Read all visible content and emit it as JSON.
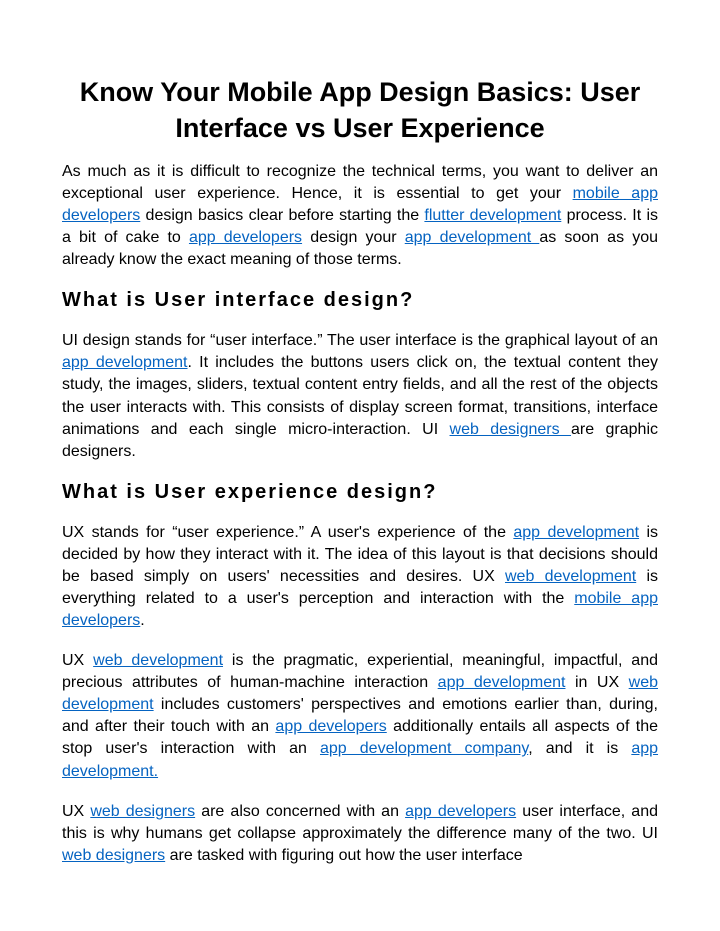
{
  "title": "Know Your Mobile App Design Basics: User Interface vs User Experience",
  "p1": {
    "t1": "As much as it is difficult to recognize the technical terms, you want to deliver an exceptional user experience. Hence, it is essential to get your ",
    "l1": "mobile app developers",
    "t2": " design basics clear before starting the ",
    "l2": "flutter development",
    "t3": " process. It is a bit of cake to ",
    "l3": "app developers",
    "t4": " design your ",
    "l4": "app development ",
    "t5": "as soon as you already know the exact meaning of those terms."
  },
  "h2a": "What is User interface design?",
  "p2": {
    "t1": "UI design stands for “user interface.” The user interface is the graphical layout of an ",
    "l1": "app development",
    "t2": ". It includes the buttons users click on, the textual content they study, the images, sliders, textual content entry fields, and all the rest of the objects the user interacts with. This consists of display screen format, transitions, interface animations and each single micro-interaction. UI ",
    "l2": "web designers ",
    "t3": "are graphic designers."
  },
  "h2b": "What is User experience design?",
  "p3": {
    "t1": "UX stands for “user experience.” A user's experience of the ",
    "l1": "app development",
    "t2": " is decided by how they interact with it. The idea of this layout is that decisions should be based simply on users' necessities and desires. UX ",
    "l2": "web development",
    "t3": " is everything related to a user's perception and interaction with the ",
    "l3": "mobile app developers",
    "t4": "."
  },
  "p4": {
    "t1": "UX ",
    "l1": "web development",
    "t2": " is the pragmatic, experiential, meaningful, impactful, and precious attributes of human-machine interaction ",
    "l2": "app development",
    "t3": " in UX ",
    "l3": "web development",
    "t4": " includes customers' perspectives and emotions earlier than, during, and after their touch with an ",
    "l4": "app developers",
    "t5": " additionally entails all aspects of the stop user's interaction with an ",
    "l5": "app development company",
    "t6": ", and it is ",
    "l6": "app development."
  },
  "p5": {
    "t1": "UX ",
    "l1": "web designers",
    "t2": " are also concerned with an ",
    "l2": "app developers",
    "t3": " user interface, and this is why humans get collapse approximately the difference many of the two. UI ",
    "l3": "web designers",
    "t4": " are tasked with figuring out how the user interface"
  }
}
